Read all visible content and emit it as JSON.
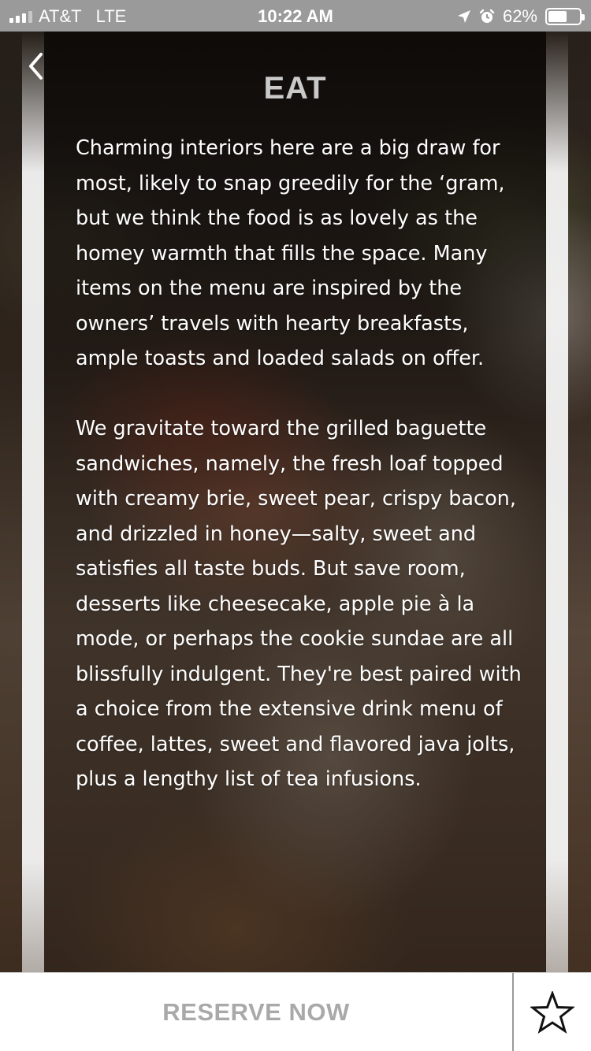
{
  "status_bar": {
    "carrier": "AT&T",
    "network": "LTE",
    "time": "10:22 AM",
    "battery_percent": "62%",
    "battery_level": 0.62,
    "icons": [
      "signal-icon",
      "location-arrow-icon",
      "alarm-icon",
      "battery-icon"
    ]
  },
  "nav": {
    "back_icon": "chevron-left-icon"
  },
  "section": {
    "title": "EAT",
    "paragraphs": [
      "Charming interiors here are a big draw for most, likely to snap greedily for the ‘gram, but we think the food is as lovely as the homey warmth that fills the space. Many items on the menu are inspired by the owners’ travels with hearty breakfasts, ample toasts and loaded salads on offer.",
      "We gravitate toward the grilled baguette sandwiches, namely, the fresh loaf topped with creamy brie, sweet pear, crispy bacon, and drizzled in honey—salty, sweet and satisfies all taste buds. But save room, desserts like cheesecake, apple pie à la mode, or perhaps the cookie sundae are all blissfully indulgent. They're best paired with a choice from the extensive drink menu of coffee, lattes, sweet and flavored java jolts, plus a lengthy list of tea infusions."
    ]
  },
  "actions": {
    "reserve_label": "RESERVE NOW",
    "favorite_icon": "star-outline-icon"
  },
  "colors": {
    "status_bar_bg": "#9a9a9a",
    "title_color": "#c9c9c9",
    "text_color": "#ffffff",
    "reserve_text": "#a9a9a9",
    "bottom_bar_bg": "#ffffff"
  }
}
